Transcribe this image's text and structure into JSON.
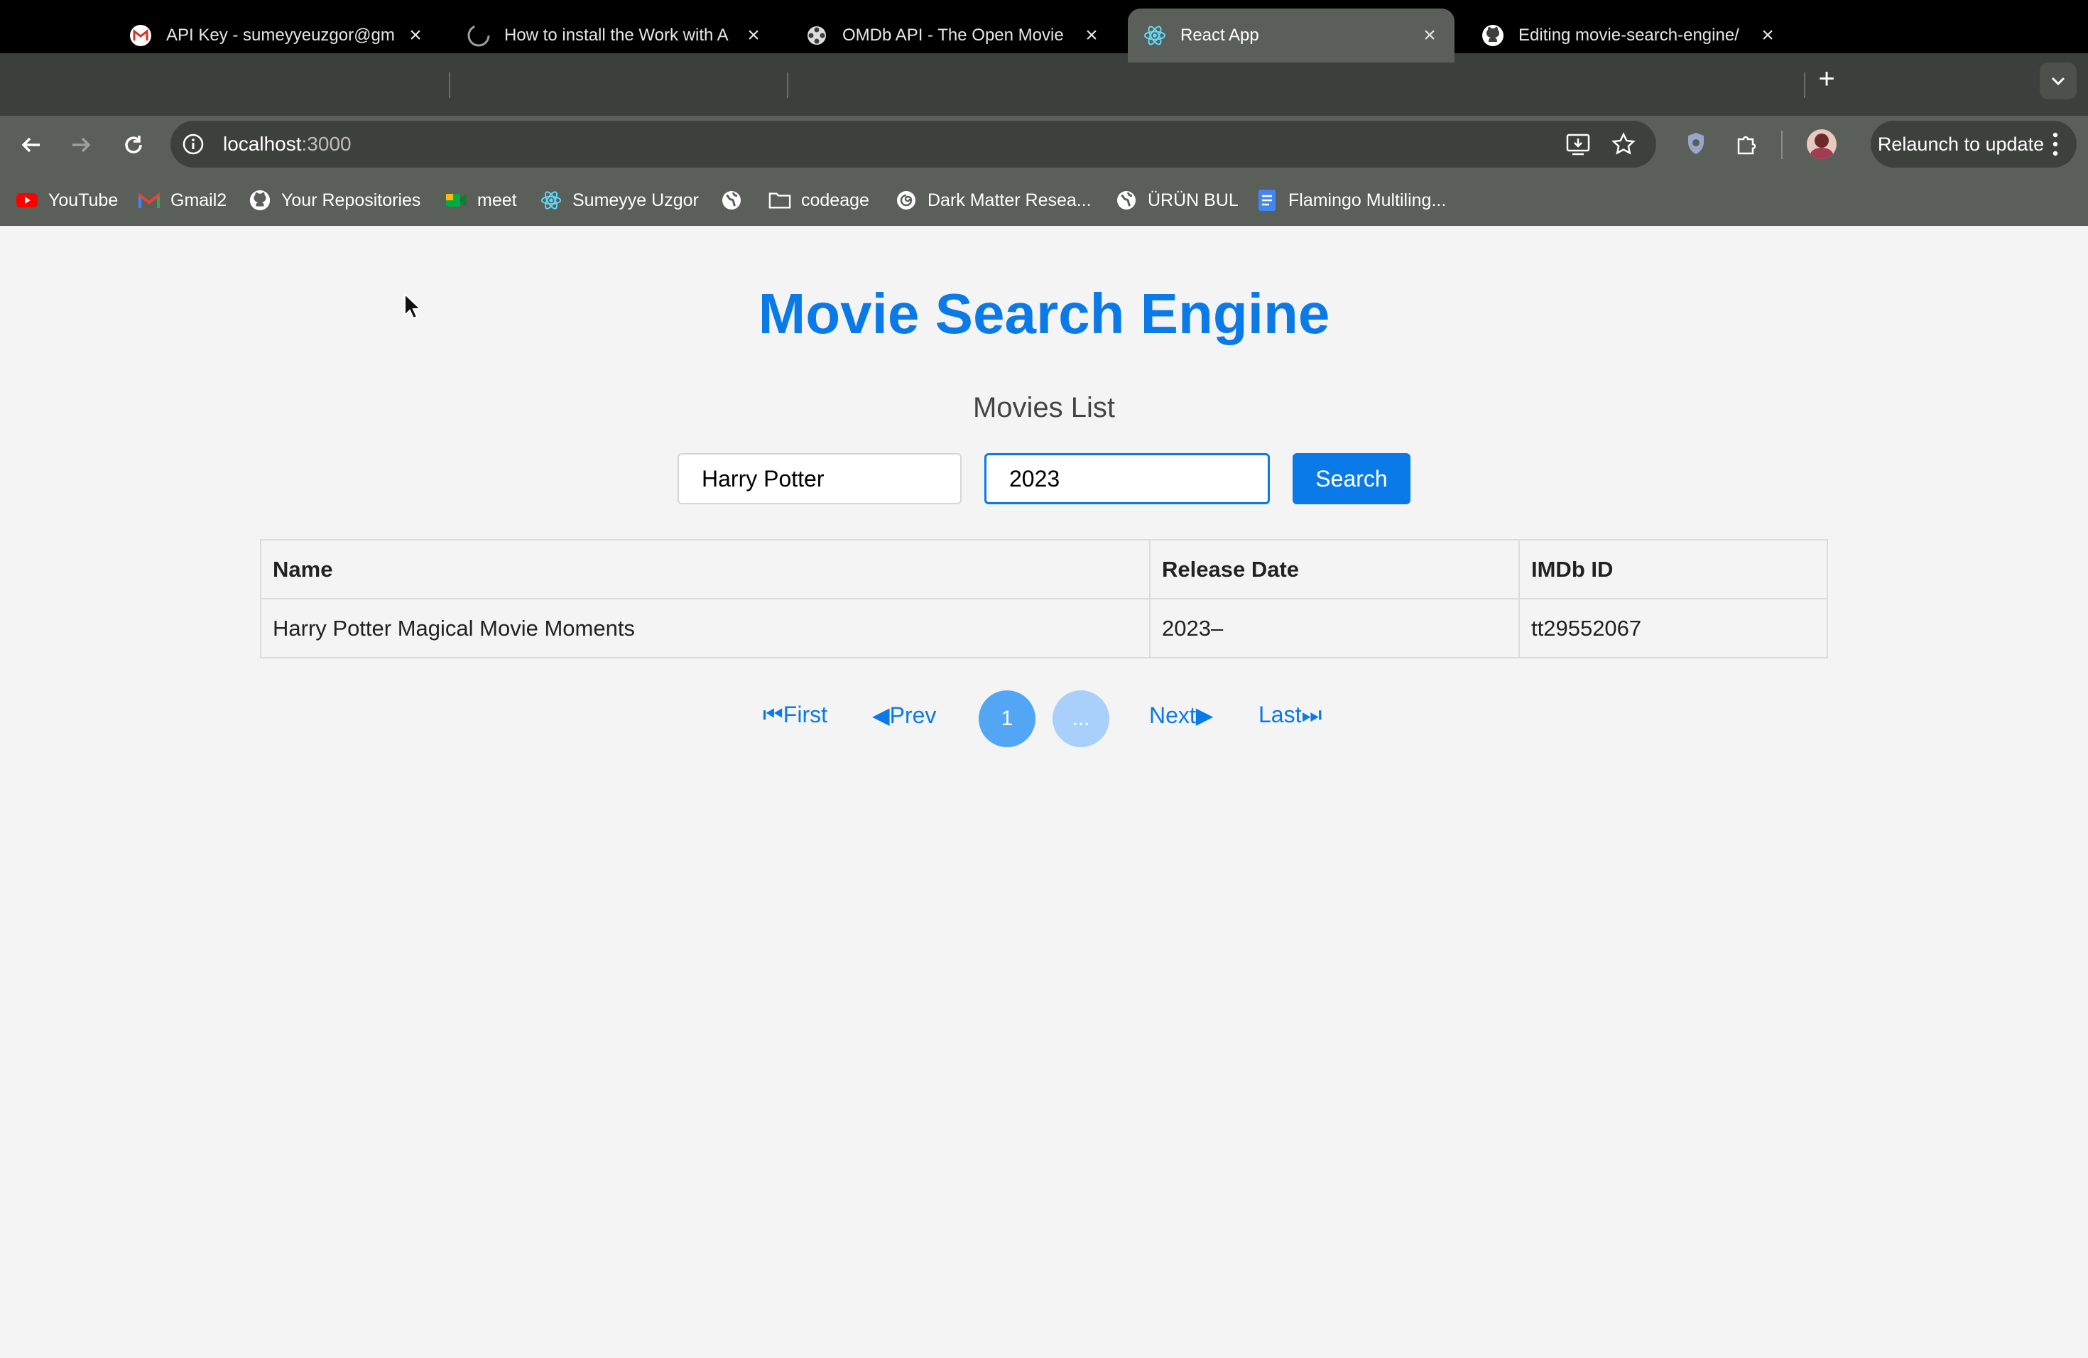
{
  "browser": {
    "tabs": [
      {
        "title": "API Key - sumeyyeuzgor@gm",
        "icon": "gmail-icon"
      },
      {
        "title": "How to install the Work with A",
        "icon": "loading-spinner-icon"
      },
      {
        "title": "OMDb API - The Open Movie",
        "icon": "film-reel-icon"
      },
      {
        "title": "React App",
        "icon": "react-icon",
        "active": true
      },
      {
        "title": "Editing movie-search-engine/",
        "icon": "github-icon"
      }
    ],
    "address": {
      "host": "localhost",
      "port": ":3000"
    },
    "relaunch_label": "Relaunch to update",
    "bookmarks": [
      {
        "label": "YouTube",
        "icon": "youtube-icon"
      },
      {
        "label": "Gmail2",
        "icon": "gmail-icon"
      },
      {
        "label": "Your Repositories",
        "icon": "github-icon"
      },
      {
        "label": "meet",
        "icon": "meet-icon"
      },
      {
        "label": "Sumeyye Uzgor",
        "icon": "react-icon"
      },
      {
        "label": "",
        "icon": "globe-icon"
      },
      {
        "label": "codeage",
        "icon": "folder-icon"
      },
      {
        "label": "Dark Matter Resea...",
        "icon": "swirl-icon"
      },
      {
        "label": "ÜRÜN BUL",
        "icon": "globe-icon"
      },
      {
        "label": "Flamingo Multiling...",
        "icon": "docs-icon"
      }
    ]
  },
  "app": {
    "title": "Movie Search Engine",
    "subtitle": "Movies List",
    "search": {
      "title_value": "Harry Potter",
      "year_value": "2023",
      "button_label": "Search"
    },
    "table": {
      "headers": [
        "Name",
        "Release Date",
        "IMDb ID"
      ],
      "rows": [
        [
          "Harry Potter Magical Movie Moments",
          "2023–",
          "tt29552067"
        ]
      ]
    },
    "pagination": {
      "first": "⏮First",
      "prev": "◀Prev",
      "current_page": "1",
      "ellipsis": "...",
      "next": "Next▶",
      "last": "Last⏭"
    }
  },
  "colors": {
    "accent": "#0a7ae8",
    "page_bg": "#f4f4f4",
    "chrome_dark": "#3c403c",
    "chrome_mid": "#5a5f59"
  }
}
